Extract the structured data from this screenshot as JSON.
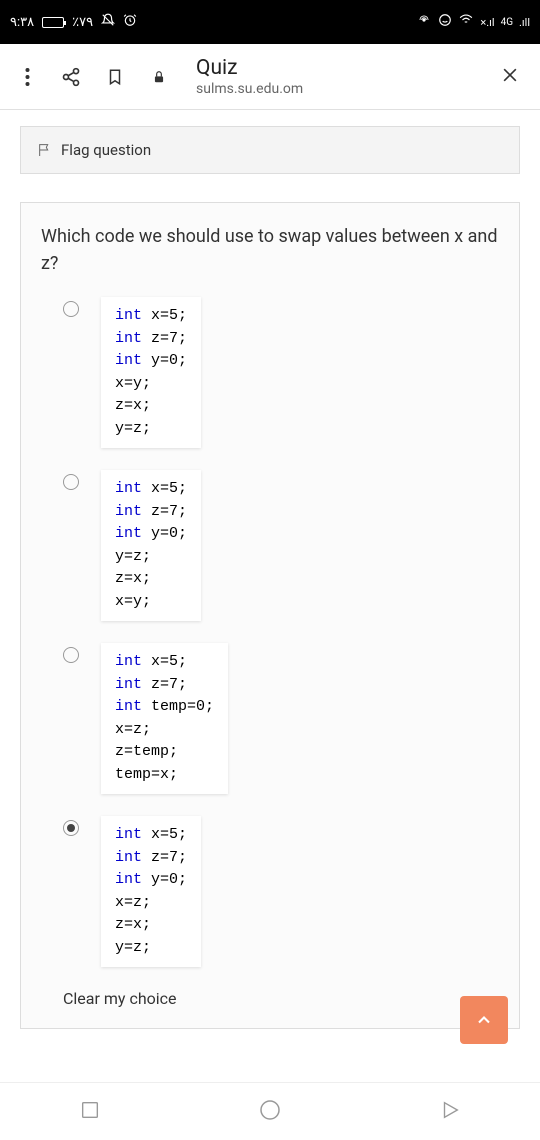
{
  "status": {
    "time": "٩:٣٨",
    "battery_pct": "٪٧٩",
    "network": "4G"
  },
  "browser": {
    "title": "Quiz",
    "url": "sulms.su.edu.om"
  },
  "flag": {
    "label": "Flag question"
  },
  "question": {
    "text": "Which code we should use to swap values between x and z?",
    "options": [
      {
        "code": "int x=5;\nint z=7;\nint y=0;\nx=y;\nz=x;\ny=z;",
        "selected": false
      },
      {
        "code": "int x=5;\nint z=7;\nint y=0;\ny=z;\nz=x;\nx=y;",
        "selected": false
      },
      {
        "code": "int x=5;\nint z=7;\nint temp=0;\nx=z;\nz=temp;\ntemp=x;",
        "selected": false
      },
      {
        "code": "int x=5;\nint z=7;\nint y=0;\nx=z;\nz=x;\ny=z;",
        "selected": true
      }
    ],
    "clear_label": "Clear my choice"
  }
}
